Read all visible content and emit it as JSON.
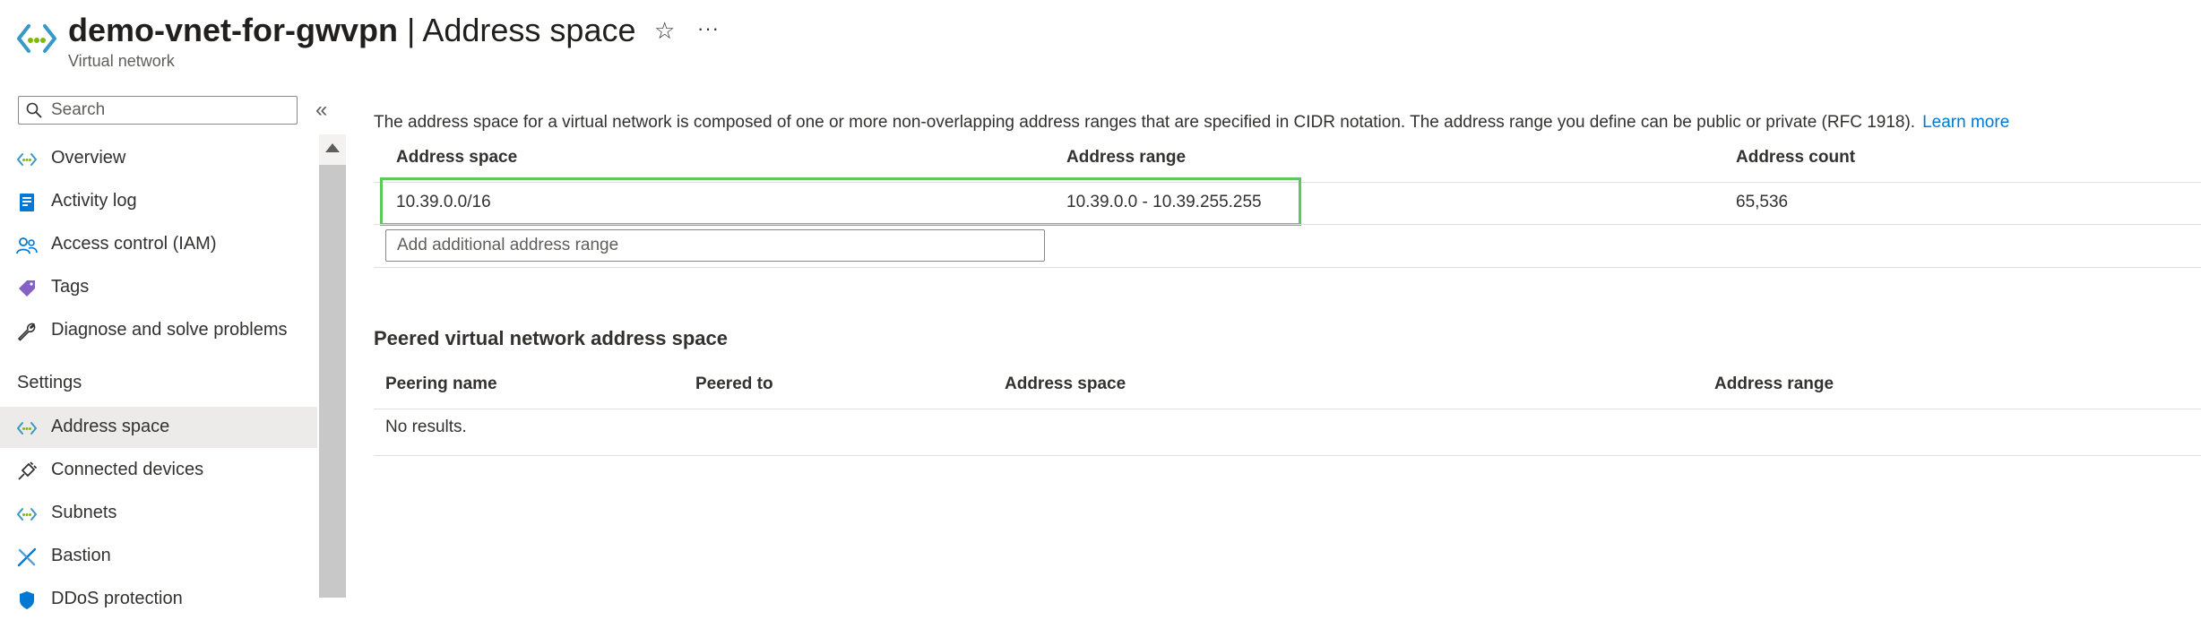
{
  "header": {
    "resource_name": "demo-vnet-for-gwvpn",
    "separator": " | ",
    "page_name": "Address space",
    "subtitle": "Virtual network",
    "favorite_glyph": "☆",
    "more_glyph": "···",
    "icon": "virtual-network-icon"
  },
  "sidebar": {
    "search_placeholder": "Search",
    "collapse_glyph": "«",
    "items": [
      {
        "label": "Overview",
        "icon": "virtual-network-icon"
      },
      {
        "label": "Activity log",
        "icon": "activity-log-icon"
      },
      {
        "label": "Access control (IAM)",
        "icon": "iam-people-icon"
      },
      {
        "label": "Tags",
        "icon": "tag-icon"
      },
      {
        "label": "Diagnose and solve problems",
        "icon": "wrench-icon"
      }
    ],
    "settings_header": "Settings",
    "settings_items": [
      {
        "label": "Address space",
        "icon": "virtual-network-icon",
        "selected": true
      },
      {
        "label": "Connected devices",
        "icon": "plug-icon"
      },
      {
        "label": "Subnets",
        "icon": "virtual-network-icon"
      },
      {
        "label": "Bastion",
        "icon": "bastion-icon"
      },
      {
        "label": "DDoS protection",
        "icon": "shield-icon"
      }
    ]
  },
  "content": {
    "description": "The address space for a virtual network is composed of one or more non-overlapping address ranges that are specified in CIDR notation. The address range you define can be public or private (RFC 1918).",
    "learn_more": "Learn more",
    "address_table": {
      "columns": [
        "Address space",
        "Address range",
        "Address count"
      ],
      "rows": [
        [
          "10.39.0.0/16",
          "10.39.0.0 - 10.39.255.255",
          "65,536"
        ]
      ],
      "add_placeholder": "Add additional address range"
    },
    "peered": {
      "title": "Peered virtual network address space",
      "columns": [
        "Peering name",
        "Peered to",
        "Address space",
        "Address range"
      ],
      "empty_text": "No results."
    }
  },
  "colors": {
    "accent": "#0078d4",
    "highlight_border": "#5ec75e",
    "selected_bg": "#edebe9"
  }
}
